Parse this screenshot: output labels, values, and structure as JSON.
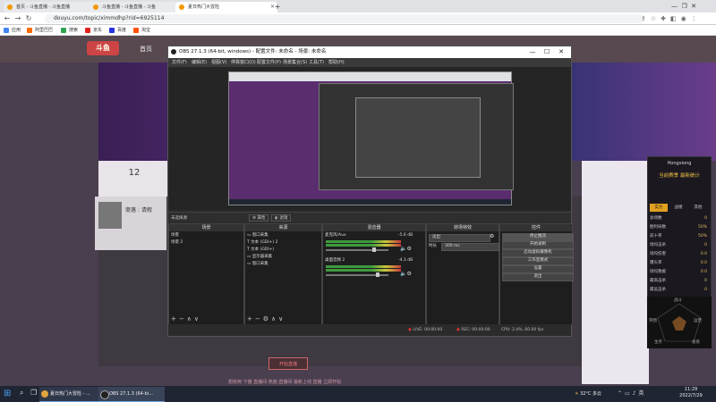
{
  "browser": {
    "tabs": [
      {
        "label": "首页 - 斗鱼直播 - 斗鱼直播",
        "color": "#f39800"
      },
      {
        "label": "斗鱼直播 - 斗鱼直播 - 斗鱼",
        "color": "#f39800"
      },
      {
        "label": "夏日热门大冒险",
        "color": "#f39800"
      }
    ],
    "new_tab": "+",
    "url": "douyu.com/topic/ximmdhp?rid=6925114",
    "bookmarks": [
      {
        "label": "应用",
        "color": "#4285f4"
      },
      {
        "label": "阿里巴巴",
        "color": "#ff6a00"
      },
      {
        "label": "搜索",
        "color": "#2ea44f"
      },
      {
        "label": "京东",
        "color": "#e1251b"
      },
      {
        "label": "百度",
        "color": "#2932e1"
      },
      {
        "label": "淘宝",
        "color": "#ff5000"
      }
    ]
  },
  "site": {
    "logo": "斗鱼",
    "nav_home": "首页",
    "room_count": "12",
    "streamer_name": "斋落 : 请假",
    "live_button": "开始直播",
    "bottom_text": "想抢到 下播 直播间 热度,直播间 最新上线 直播 立即开始",
    "rank_title": "Hongxiong",
    "rank_subtitle": "当前赛季 最新统计",
    "rank_tabs": [
      "实力",
      "战绩",
      "其他"
    ],
    "rank_rows": [
      {
        "label": "总场数",
        "value": "0"
      },
      {
        "label": "胜利局数",
        "value": "50%"
      },
      {
        "label": "前十率",
        "value": "50%"
      },
      {
        "label": "场均击杀",
        "value": "0"
      },
      {
        "label": "场均伤害",
        "value": "0.0"
      },
      {
        "label": "爆头率",
        "value": "0.0"
      },
      {
        "label": "场均救援",
        "value": "0.0"
      },
      {
        "label": "最高击杀",
        "value": "0"
      },
      {
        "label": "最远击杀",
        "value": "0"
      }
    ],
    "radar_labels": [
      "战斗",
      "生存",
      "运营",
      "突围",
      "发育"
    ]
  },
  "obs": {
    "title": "OBS 27.1.3 (64-bit, windows) - 配置文件: 未命名 - 场景: 未命名",
    "menu": [
      "文件(F)",
      "编辑(E)",
      "视图(V)",
      "停靠窗口(D)",
      "配置文件(P)",
      "场景集合(S)",
      "工具(T)",
      "帮助(H)"
    ],
    "no_source": "未选择源",
    "props_btn": "属性",
    "filters_btn": "滤镜",
    "docks": {
      "scenes": {
        "title": "场景",
        "items": [
          "场景",
          "场景 2"
        ]
      },
      "sources": {
        "title": "来源",
        "items": [
          "窗口采集",
          "文本 (GDI+) 2",
          "文本 (GDI+)",
          "显示器采集",
          "窗口采集"
        ]
      },
      "mixer": {
        "title": "混音器",
        "ch1": "麦克风/Aux",
        "ch1_db": "-5.6 dB",
        "ch2": "桌面音频 2",
        "ch2_db": "-4.3 dB"
      },
      "transitions": {
        "title": "转场特效",
        "type": "淡出",
        "duration_label": "时长",
        "duration": "300 ms"
      },
      "controls": {
        "title": "控件",
        "buttons": [
          "停止推流",
          "开始录制",
          "启动虚拟摄像机",
          "工作室模式",
          "设置",
          "退出"
        ]
      }
    },
    "status": {
      "live": "LIVE: 00:00:00",
      "rec": "REC: 00:00:00",
      "cpu": "CPU: 2.4%, 60.00 fps"
    }
  },
  "taskbar": {
    "items": [
      {
        "label": "夏日热门大冒险 - ...",
        "color": "#e1a33b"
      },
      {
        "label": "OBS 27.1.3 (64-bi...",
        "color": "#222"
      }
    ],
    "weather": "32°C 多云",
    "time": "11:29",
    "date": "2022/7/29"
  }
}
